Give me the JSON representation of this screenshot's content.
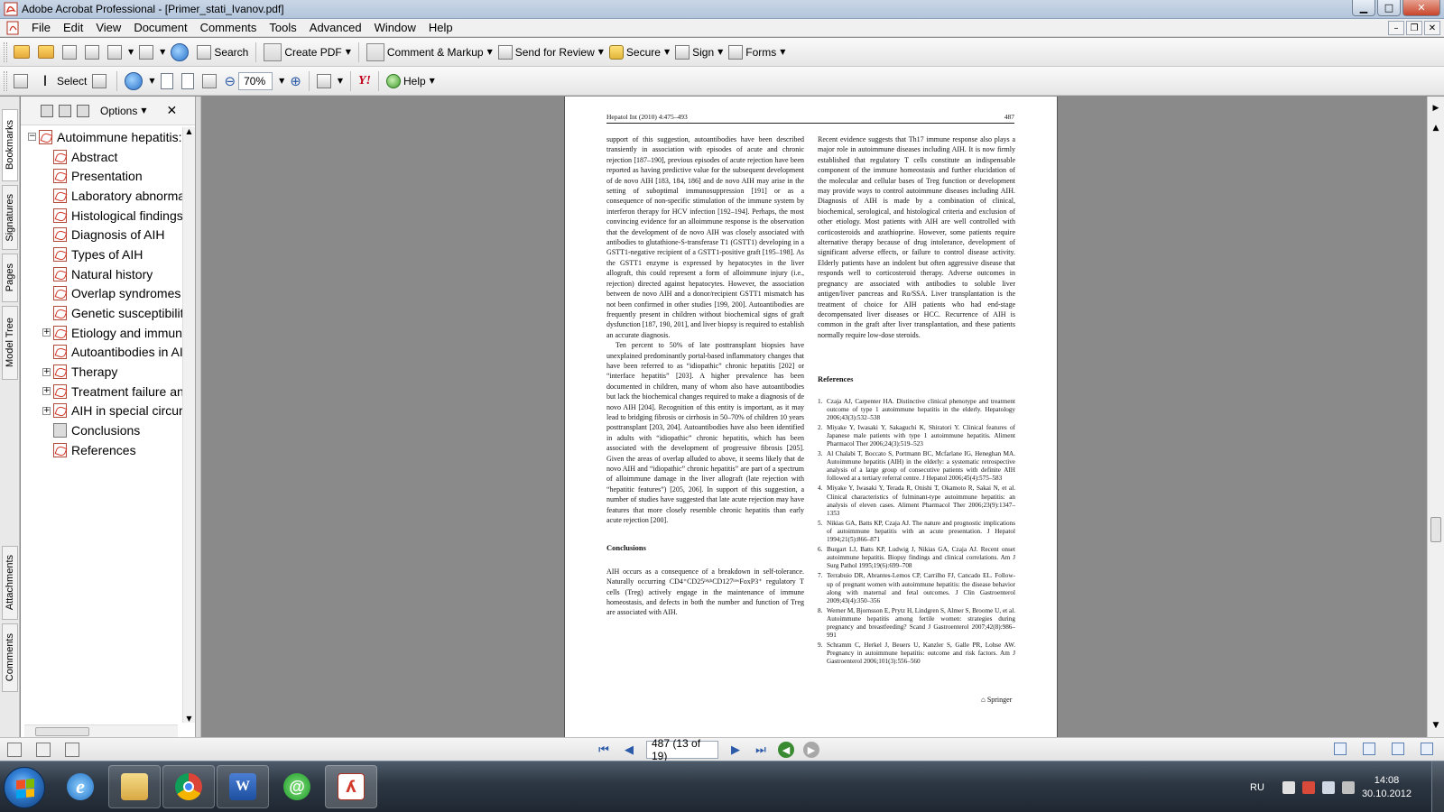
{
  "window": {
    "title": "Adobe Acrobat Professional - [Primer_stati_Ivanov.pdf]",
    "buttons": {
      "minimize": "▁",
      "maximize": "□",
      "close": "✕"
    },
    "mdi_buttons": {
      "minimize": "–",
      "restore": "❐",
      "close": "✕"
    }
  },
  "menu": [
    "File",
    "Edit",
    "View",
    "Document",
    "Comments",
    "Tools",
    "Advanced",
    "Window",
    "Help"
  ],
  "toolbar1": {
    "search": "Search",
    "create_pdf": "Create PDF",
    "comment_markup": "Comment & Markup",
    "send_review": "Send for Review",
    "secure": "Secure",
    "sign": "Sign",
    "forms": "Forms"
  },
  "toolbar2": {
    "select": "Select",
    "zoom": "70%",
    "help": "Help",
    "yahoo": "Y!"
  },
  "nav_tabs": [
    "Bookmarks",
    "Signatures",
    "Pages",
    "Model Tree",
    "Attachments",
    "Comments"
  ],
  "bookmarks": {
    "options": "Options",
    "root": "Autoimmune hepatitis:",
    "items": [
      {
        "label": "Abstract",
        "expandable": false
      },
      {
        "label": "Presentation",
        "expandable": false
      },
      {
        "label": "Laboratory abnormal",
        "expandable": false
      },
      {
        "label": "Histological findings",
        "expandable": false
      },
      {
        "label": "Diagnosis of AIH",
        "expandable": false
      },
      {
        "label": "Types of AIH",
        "expandable": false
      },
      {
        "label": "Natural history",
        "expandable": false
      },
      {
        "label": "Overlap syndromes w",
        "expandable": false
      },
      {
        "label": "Genetic susceptibilit",
        "expandable": false
      },
      {
        "label": "Etiology and immuno",
        "expandable": true
      },
      {
        "label": "Autoantibodies in AII",
        "expandable": false
      },
      {
        "label": "Therapy",
        "expandable": true
      },
      {
        "label": "Treatment failure and",
        "expandable": true
      },
      {
        "label": "AIH in special circur",
        "expandable": true
      },
      {
        "label": "Conclusions",
        "expandable": false,
        "plain": true
      },
      {
        "label": "References",
        "expandable": false
      }
    ]
  },
  "page": {
    "journal": "Hepatol Int (2010) 4:475–493",
    "page_num": "487",
    "left_col": [
      {
        "type": "p",
        "text": "support of this suggestion, autoantibodies have been described transiently in association with episodes of acute and chronic rejection [187–190], previous episodes of acute rejection have been reported as having predictive value for the subsequent development of de novo AIH [183, 184, 186] and de novo AIH may arise in the setting of suboptimal immunosuppression [191] or as a consequence of non-specific stimulation of the immune system by interferon therapy for HCV infection [192–194]. Perhaps, the most convincing evidence for an alloimmune response is the observation that the development of de novo AIH was closely associated with antibodies to glutathione-S-transferase T1 (GSTT1) developing in a GSTT1-negative recipient of a GSTT1-positive graft [195–198]. As the GSTT1 enzyme is expressed by hepatocytes in the liver allograft, this could represent a form of alloimmune injury (i.e., rejection) directed against hepatocytes. However, the association between de novo AIH and a donor/recipient GSTT1 mismatch has not been confirmed in other studies [199, 200]. Autoantibodies are frequently present in children without biochemical signs of graft dysfunction [187, 190, 201], and liver biopsy is required to establish an accurate diagnosis."
      },
      {
        "type": "pi",
        "text": "Ten percent to 50% of late posttransplant biopsies have unexplained predominantly portal-based inflammatory changes that have been referred to as “idiopathic” chronic hepatitis [202] or “interface hepatitis” [203]. A higher prevalence has been documented in children, many of whom also have autoantibodies but lack the biochemical changes required to make a diagnosis of de novo AIH [204]. Recognition of this entity is important, as it may lead to bridging fibrosis or cirrhosis in 50–70% of children 10 years posttransplant [203, 204]. Autoantibodies have also been identified in adults with “idiopathic” chronic hepatitis, which has been associated with the development of progressive fibrosis [205]. Given the areas of overlap alluded to above, it seems likely that de novo AIH and “idiopathic” chronic hepatitis” are part of a spectrum of alloimmune damage in the liver allograft (late rejection with “hepatitic features”) [205, 206]. In support of this suggestion, a number of studies have suggested that late acute rejection may have features that more closely resemble chronic hepatitis than early acute rejection [200]."
      },
      {
        "type": "h",
        "text": "Conclusions"
      },
      {
        "type": "p",
        "text": "AIH occurs as a consequence of a breakdown in self-tolerance. Naturally occurring CD4⁺CD25ʰⁱᵍʰCD127ˡᵒʷFoxP3⁺ regulatory T cells (Treg) actively engage in the maintenance of immune homeostasis, and defects in both the number and function of Treg are associated with AIH."
      }
    ],
    "right_col_text": "Recent evidence suggests that Th17 immune response also plays a major role in autoimmune diseases including AIH. It is now firmly established that regulatory T cells constitute an indispensable component of the immune homeostasis and further elucidation of the molecular and cellular bases of Treg function or development may provide ways to control autoimmune diseases including AIH. Diagnosis of AIH is made by a combination of clinical, biochemical, serological, and histological criteria and exclusion of other etiology. Most patients with AIH are well controlled with corticosteroids and azathioprine. However, some patients require alternative therapy because of drug intolerance, development of significant adverse effects, or failure to control disease activity. Elderly patients have an indolent but often aggressive disease that responds well to corticosteroid therapy. Adverse outcomes in pregnancy are associated with antibodies to soluble liver antigen/liver pancreas and Ro/SSA. Liver transplantation is the treatment of choice for AIH patients who had end-stage decompensated liver diseases or HCC. Recurrence of AIH is common in the graft after liver transplantation, and these patients normally require low-dose steroids.",
    "references_heading": "References",
    "references": [
      "Czaja AJ, Carpenter HA. Distinctive clinical phenotype and treatment outcome of type 1 autoimmune hepatitis in the elderly. Hepatology 2006;43(3):532–538",
      "Miyake Y, Iwasaki Y, Sakaguchi K, Shiratori Y. Clinical features of Japanese male patients with type 1 autoimmune hepatitis. Aliment Pharmacol Ther 2006;24(3):519–523",
      "Al Chalabi T, Boccato S, Portmann BC, Mcfarlane IG, Heneghan MA. Autoimmune hepatitis (AIH) in the elderly: a systematic retrospective analysis of a large group of consecutive patients with definite AIH followed at a tertiary referral centre. J Hepatol 2006;45(4):575–583",
      "Miyake Y, Iwasaki Y, Terada R, Onishi T, Okamoto R, Sakai N, et al. Clinical characteristics of fulminant-type autoimmune hepatitis: an analysis of eleven cases. Aliment Pharmacol Ther 2006;23(9):1347–1353",
      "Nikias GA, Batts KP, Czaja AJ. The nature and prognostic implications of autoimmune hepatitis with an acute presentation. J Hepatol 1994;21(5):866–871",
      "Burgart LJ, Batts KP, Ludwig J, Nikias GA, Czaja AJ. Recent onset autoimmune hepatitis. Biopsy findings and clinical correlations. Am J Surg Pathol 1995;19(6):699–708",
      "Terrabuio DR, Abrantes-Lemos CP, Carrilho FJ, Cancado EL. Follow-up of pregnant women with autoimmune hepatitis: the disease behavior along with maternal and fetal outcomes. J Clin Gastroenterol 2009;43(4):350–356",
      "Werner M, Bjornsson E, Prytz H, Lindgren S, Almer S, Broome U, et al. Autoimmune hepatitis among fertile women: strategies during pregnancy and breastfeeding? Scand J Gastroenterol 2007;42(8):986–991",
      "Schramm C, Herkel J, Beuers U, Kanzler S, Galle PR, Lohse AW. Pregnancy in autoimmune hepatitis: outcome and risk factors. Am J Gastroenterol 2006;101(3):556–560"
    ],
    "publisher": "Springer"
  },
  "status": {
    "page_indicator": "487 (13 of 19)"
  },
  "taskbar": {
    "lang": "RU",
    "time": "14:08",
    "date": "30.10.2012"
  },
  "colors": {
    "link": "#1a4fb8",
    "pdf_icon": "#d2392a",
    "taskbar": "#2c3642"
  }
}
